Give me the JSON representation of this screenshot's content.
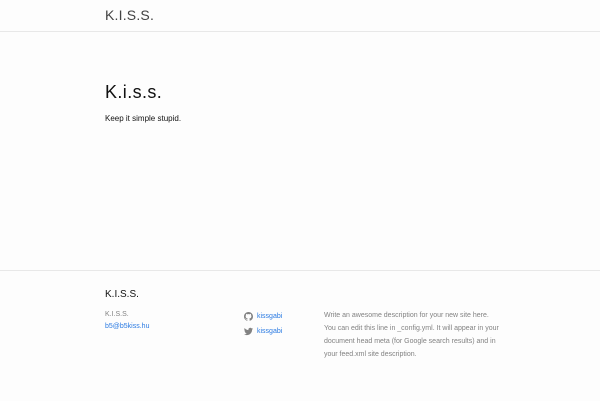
{
  "header": {
    "site_title": "K.I.S.S."
  },
  "main": {
    "title": "K.i.s.s.",
    "text": "Keep it simple stupid."
  },
  "footer": {
    "heading": "K.I.S.S.",
    "name": "K.I.S.S.",
    "email": "b5@b5kiss.hu",
    "social": [
      {
        "icon": "github-icon",
        "label": "kissgabi"
      },
      {
        "icon": "twitter-icon",
        "label": "kissgabi"
      }
    ],
    "description": "Write an awesome description for your new site here. You can edit this line in _config.yml. It will appear in your document head meta (for Google search results) and in your feed.xml site description."
  },
  "colors": {
    "link": "#2a7ae2",
    "muted": "#828282",
    "border": "#e8e8e8"
  }
}
